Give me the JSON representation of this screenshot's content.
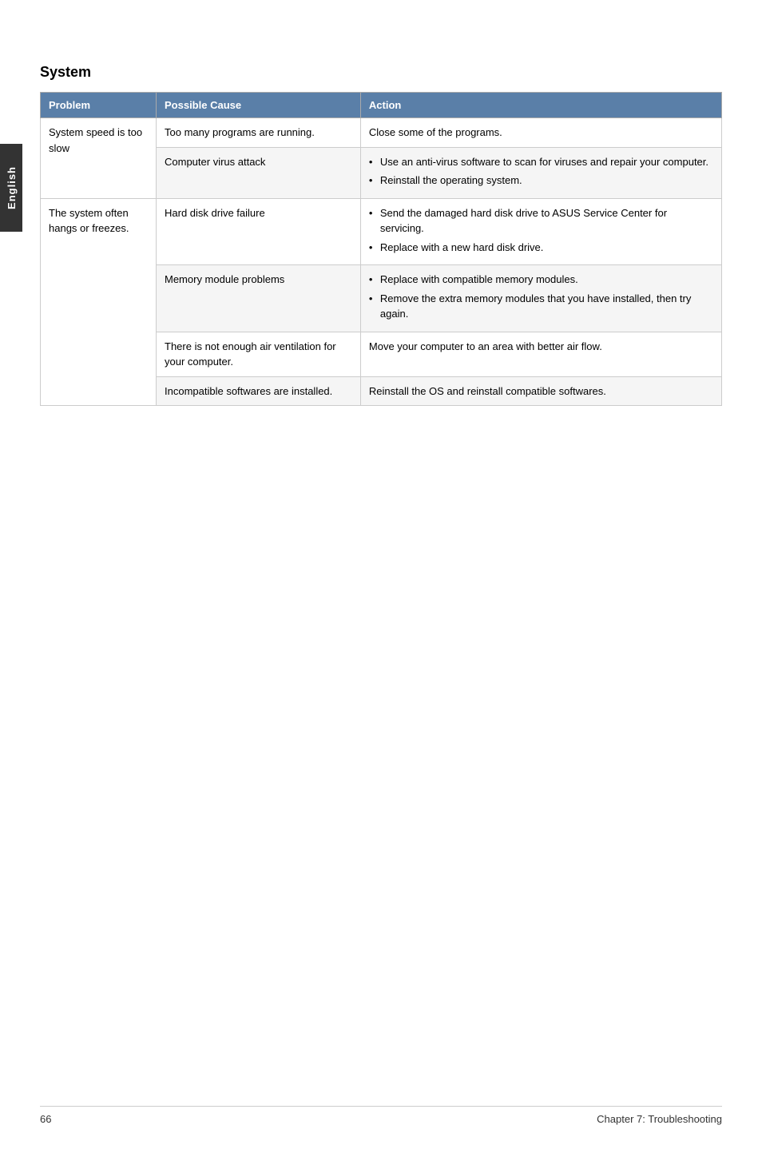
{
  "side_tab": {
    "label": "English"
  },
  "section": {
    "title": "System"
  },
  "table": {
    "headers": {
      "problem": "Problem",
      "cause": "Possible Cause",
      "action": "Action"
    },
    "rows": [
      {
        "problem": "System speed is too slow",
        "cause": "Too many programs are running.",
        "action_type": "text",
        "action": "Close some of the programs."
      },
      {
        "problem": "",
        "cause": "Computer virus attack",
        "action_type": "bullets",
        "action_bullets": [
          "Use an anti-virus software to scan for viruses and repair your computer.",
          "Reinstall the operating system."
        ]
      },
      {
        "problem": "The system often hangs or freezes.",
        "cause": "Hard disk drive failure",
        "action_type": "bullets",
        "action_bullets": [
          "Send the damaged hard disk drive to ASUS Service Center for servicing.",
          "Replace with a new hard disk drive."
        ]
      },
      {
        "problem": "",
        "cause": "Memory module problems",
        "action_type": "bullets",
        "action_bullets": [
          "Replace with compatible memory modules.",
          "Remove the extra memory modules that you have installed, then try again."
        ]
      },
      {
        "problem": "",
        "cause": "There is not enough air ventilation for your computer.",
        "action_type": "text",
        "action": "Move your computer to an area with better air flow."
      },
      {
        "problem": "",
        "cause": "Incompatible softwares are installed.",
        "action_type": "text",
        "action": "Reinstall the OS and reinstall compatible softwares."
      }
    ]
  },
  "footer": {
    "page_number": "66",
    "chapter": "Chapter 7: Troubleshooting"
  }
}
